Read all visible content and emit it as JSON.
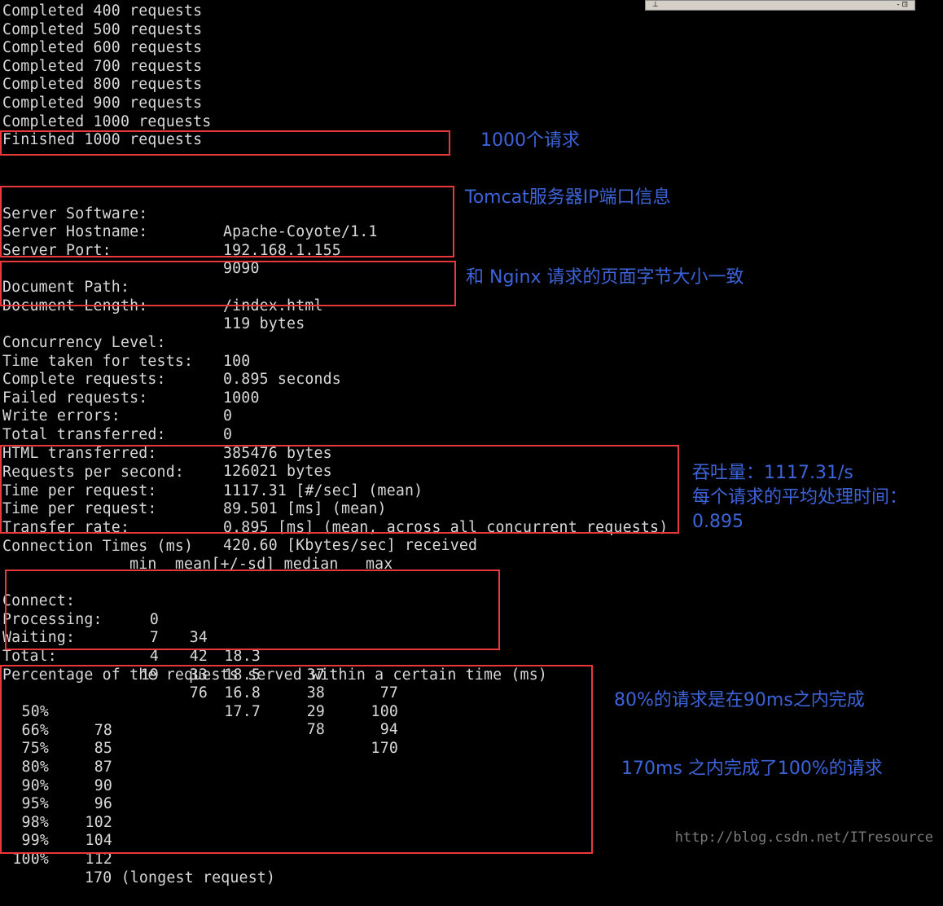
{
  "window_bar": {
    "pin_icon": "pin-icon",
    "controls": "- ⊡"
  },
  "progress_lines": [
    "Completed 400 requests",
    "Completed 500 requests",
    "Completed 600 requests",
    "Completed 700 requests",
    "Completed 800 requests",
    "Completed 900 requests",
    "Completed 1000 requests"
  ],
  "finished_line": "Finished 1000 requests",
  "server": [
    {
      "key": "Server Software:",
      "value": "Apache-Coyote/1.1"
    },
    {
      "key": "Server Hostname:",
      "value": "192.168.1.155"
    },
    {
      "key": "Server Port:",
      "value": "9090"
    }
  ],
  "document": [
    {
      "key": "Document Path:",
      "value": "/index.html"
    },
    {
      "key": "Document Length:",
      "value": "119 bytes"
    }
  ],
  "stats": [
    {
      "key": "Concurrency Level:",
      "value": "100"
    },
    {
      "key": "Time taken for tests:",
      "value": "0.895 seconds"
    },
    {
      "key": "Complete requests:",
      "value": "1000"
    },
    {
      "key": "Failed requests:",
      "value": "0"
    },
    {
      "key": "Write errors:",
      "value": "0"
    },
    {
      "key": "Total transferred:",
      "value": "385476 bytes"
    },
    {
      "key": "HTML transferred:",
      "value": "126021 bytes"
    }
  ],
  "rates": [
    {
      "key": "Requests per second:",
      "value": "1117.31 [#/sec] (mean)"
    },
    {
      "key": "Time per request:",
      "value": "89.501 [ms] (mean)"
    },
    {
      "key": "Time per request:",
      "value": "0.895 [ms] (mean, across all concurrent requests)"
    },
    {
      "key": "Transfer rate:",
      "value": "420.60 [Kbytes/sec] received"
    }
  ],
  "connection_times": {
    "title": "Connection Times (ms)",
    "header": "              min  mean[+/-sd] median   max",
    "rows": [
      {
        "label": "Connect:",
        "min": "0",
        "mean": "34",
        "sd": "18.3",
        "median": "37",
        "max": "77"
      },
      {
        "label": "Processing:",
        "min": "7",
        "mean": "42",
        "sd": "18.5",
        "median": "38",
        "max": "100"
      },
      {
        "label": "Waiting:",
        "min": "4",
        "mean": "33",
        "sd": "16.8",
        "median": "29",
        "max": "94"
      },
      {
        "label": "Total:",
        "min": "19",
        "mean": "76",
        "sd": "17.7",
        "median": "78",
        "max": "170"
      }
    ]
  },
  "percentiles": {
    "title": "Percentage of the requests served within a certain time (ms)",
    "rows": [
      {
        "pct": "50%",
        "ms": "78"
      },
      {
        "pct": "66%",
        "ms": "85"
      },
      {
        "pct": "75%",
        "ms": "87"
      },
      {
        "pct": "80%",
        "ms": "90"
      },
      {
        "pct": "90%",
        "ms": "96"
      },
      {
        "pct": "95%",
        "ms": "102"
      },
      {
        "pct": "98%",
        "ms": "104"
      },
      {
        "pct": "99%",
        "ms": "112"
      },
      {
        "pct": "100%",
        "ms": "170 (longest request)"
      }
    ]
  },
  "annotations": {
    "requests": "1000个请求",
    "server": "Tomcat服务器IP端口信息",
    "document": "和 Nginx 请求的页面字节大小一致",
    "throughput_1": "吞吐量：1117.31/s",
    "throughput_2": "每个请求的平均处理时间：",
    "throughput_3": "0.895",
    "p80": "80%的请求是在90ms之内完成",
    "p100": "170ms 之内完成了100%的请求"
  },
  "watermark": "http://blog.csdn.net/ITresource",
  "colors": {
    "background": "#000000",
    "text": "#d9d9d9",
    "highlight_box": "#e8383d",
    "annotation": "#3d63d8"
  }
}
